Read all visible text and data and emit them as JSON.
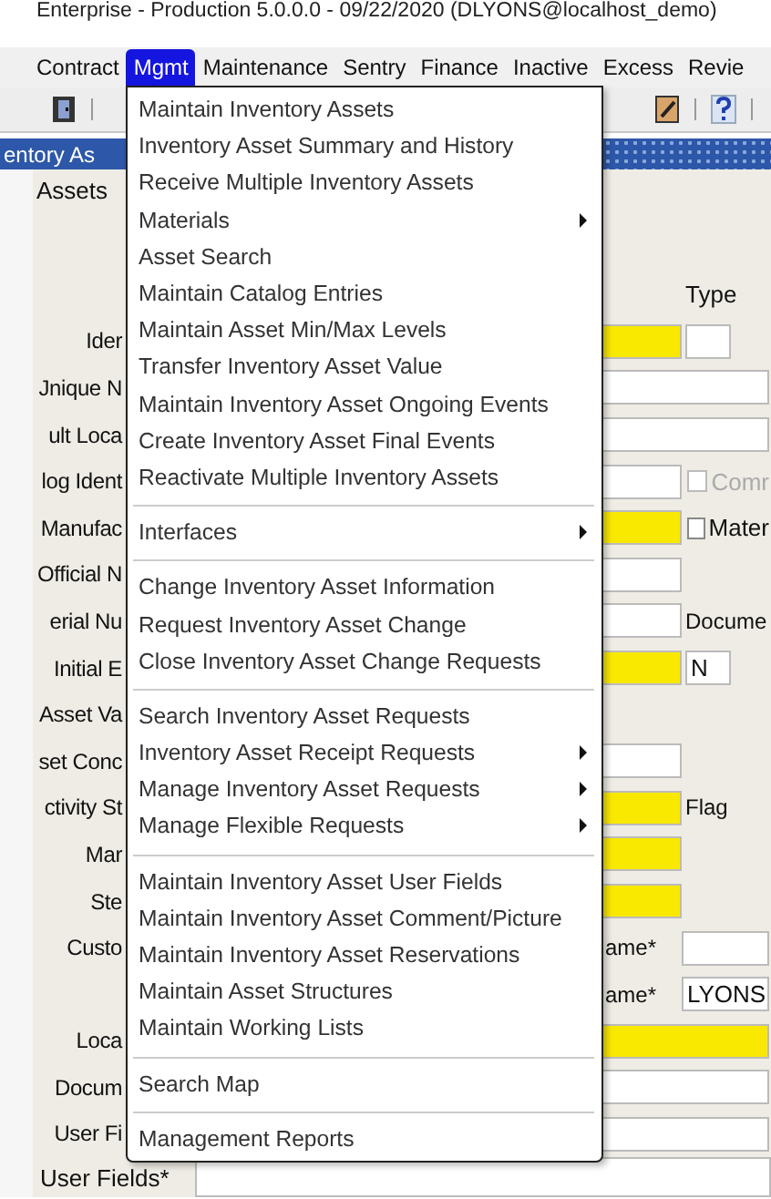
{
  "window": {
    "title": "Enterprise - Production 5.0.0.0 - 09/22/2020 (DLYONS@localhost_demo)"
  },
  "menubar": [
    {
      "label": "Contract",
      "selected": false
    },
    {
      "label": "Mgmt",
      "selected": true
    },
    {
      "label": "Maintenance",
      "selected": false
    },
    {
      "label": "Sentry",
      "selected": false
    },
    {
      "label": "Finance",
      "selected": false
    },
    {
      "label": "Inactive",
      "selected": false
    },
    {
      "label": "Excess",
      "selected": false
    },
    {
      "label": "Revie",
      "selected": false
    }
  ],
  "header": {
    "title": "entory As"
  },
  "section": {
    "title": "Assets"
  },
  "form_rows": [
    {
      "right": [
        {
          "kind": "heading",
          "text": "Type"
        }
      ]
    },
    {
      "label": "Ider",
      "right": [
        {
          "kind": "field",
          "required": true
        },
        {
          "kind": "box",
          "required": false
        }
      ]
    },
    {
      "label": "Jnique N",
      "right": [
        {
          "kind": "wide",
          "required": false
        }
      ]
    },
    {
      "label": "ult Loca",
      "right": [
        {
          "kind": "wide",
          "required": false
        }
      ]
    },
    {
      "label": "log Ident",
      "right": [
        {
          "kind": "field",
          "required": false
        },
        {
          "kind": "checkbox",
          "text": "Comr",
          "checked": false,
          "disabled": true
        }
      ]
    },
    {
      "label": "Manufac",
      "right": [
        {
          "kind": "field",
          "required": true
        },
        {
          "kind": "checkbox",
          "text": "Mater",
          "checked": false,
          "disabled": false
        }
      ]
    },
    {
      "label": "Official N",
      "right": [
        {
          "kind": "field",
          "required": false
        }
      ]
    },
    {
      "label": "erial Nu",
      "right": [
        {
          "kind": "field",
          "required": false
        },
        {
          "kind": "label",
          "text": "Docume"
        }
      ]
    },
    {
      "label": "Initial E",
      "right": [
        {
          "kind": "field",
          "required": true
        },
        {
          "kind": "box",
          "required": false,
          "value": "N"
        }
      ]
    },
    {
      "label": "Asset Va",
      "right": []
    },
    {
      "label": "set Conc",
      "right": [
        {
          "kind": "field",
          "required": false
        }
      ]
    },
    {
      "label": "ctivity St",
      "right": [
        {
          "kind": "field",
          "required": true
        },
        {
          "kind": "label",
          "text": "Flag"
        }
      ]
    },
    {
      "label": "Mar",
      "right": [
        {
          "kind": "field",
          "required": true
        }
      ]
    },
    {
      "label": "Ste",
      "right": [
        {
          "kind": "field",
          "required": true
        }
      ]
    },
    {
      "label": "Custo",
      "right": [
        {
          "kind": "label",
          "text": "ame*"
        },
        {
          "kind": "field",
          "required": false
        }
      ]
    },
    {
      "right": [
        {
          "kind": "label",
          "text": "ame*"
        },
        {
          "kind": "field",
          "required": false,
          "value": "LYONS"
        }
      ]
    },
    {
      "label": "Loca",
      "right": [
        {
          "kind": "wide",
          "required": true
        }
      ]
    },
    {
      "label": "Docum",
      "right": [
        {
          "kind": "wide",
          "required": false
        }
      ]
    },
    {
      "label": "User Fi",
      "right": [
        {
          "kind": "wide",
          "required": false
        }
      ]
    },
    {
      "label": "User Fields*",
      "long_field": true,
      "right": []
    }
  ],
  "menu": {
    "groups": [
      [
        {
          "label": "Maintain Inventory Assets",
          "submenu": false
        },
        {
          "label": "Inventory Asset Summary and History",
          "submenu": false
        },
        {
          "label": "Receive Multiple Inventory Assets",
          "submenu": false
        },
        {
          "label": "Materials",
          "submenu": true
        },
        {
          "label": "Asset Search",
          "submenu": false
        },
        {
          "label": "Maintain Catalog Entries",
          "submenu": false
        },
        {
          "label": "Maintain Asset Min/Max Levels",
          "submenu": false
        },
        {
          "label": "Transfer Inventory Asset Value",
          "submenu": false
        },
        {
          "label": "Maintain Inventory Asset Ongoing Events",
          "submenu": false
        },
        {
          "label": "Create Inventory Asset Final Events",
          "submenu": false
        },
        {
          "label": "Reactivate Multiple Inventory Assets",
          "submenu": false
        }
      ],
      [
        {
          "label": "Interfaces",
          "submenu": true
        }
      ],
      [
        {
          "label": "Change Inventory Asset Information",
          "submenu": false
        },
        {
          "label": "Request Inventory Asset Change",
          "submenu": false
        },
        {
          "label": "Close Inventory Asset Change Requests",
          "submenu": false
        }
      ],
      [
        {
          "label": "Search Inventory Asset Requests",
          "submenu": false
        },
        {
          "label": "Inventory Asset Receipt Requests",
          "submenu": true
        },
        {
          "label": "Manage Inventory Asset Requests",
          "submenu": true
        },
        {
          "label": "Manage Flexible Requests",
          "submenu": true
        }
      ],
      [
        {
          "label": "Maintain Inventory Asset User Fields",
          "submenu": false
        },
        {
          "label": "Maintain Inventory Asset Comment/Picture",
          "submenu": false
        },
        {
          "label": "Maintain Inventory Asset Reservations",
          "submenu": false
        },
        {
          "label": "Maintain Asset Structures",
          "submenu": false
        },
        {
          "label": "Maintain Working Lists",
          "submenu": false
        }
      ],
      [
        {
          "label": "Search Map",
          "submenu": false
        }
      ],
      [
        {
          "label": "Management Reports",
          "submenu": false
        }
      ]
    ]
  }
}
